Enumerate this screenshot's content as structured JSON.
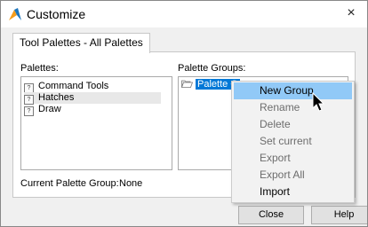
{
  "window": {
    "title": "Customize",
    "close_glyph": "×"
  },
  "tab": {
    "label": "Tool Palettes - All Palettes"
  },
  "palettes": {
    "label": "Palettes:",
    "items": [
      {
        "label": "Command Tools",
        "icon": "?"
      },
      {
        "label": "Hatches",
        "icon": "?"
      },
      {
        "label": "Draw",
        "icon": "?"
      }
    ]
  },
  "palette_groups": {
    "label": "Palette Groups:",
    "items": [
      {
        "label": "Palette G"
      }
    ]
  },
  "current_group": {
    "label": "Current Palette Group:",
    "value": "None"
  },
  "buttons": {
    "close": "Close",
    "help": "Help"
  },
  "context_menu": {
    "items": [
      {
        "label": "New Group",
        "enabled": true
      },
      {
        "label": "Rename",
        "enabled": false
      },
      {
        "label": "Delete",
        "enabled": false
      },
      {
        "label": "Set current",
        "enabled": false
      },
      {
        "label": "Export",
        "enabled": false
      },
      {
        "label": "Export All",
        "enabled": false
      },
      {
        "label": "Import",
        "enabled": true
      }
    ]
  },
  "colors": {
    "selection": "#0078d7",
    "menu_hover": "#91c9f7",
    "disabled_text": "#6d6d6d"
  }
}
